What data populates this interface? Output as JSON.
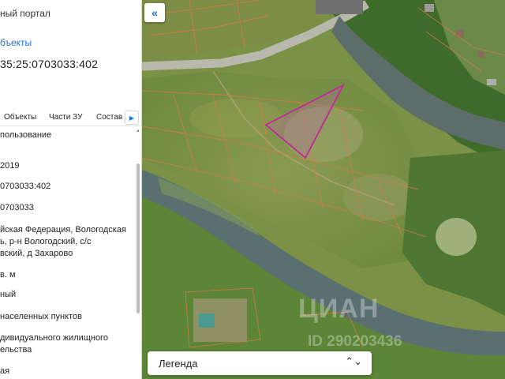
{
  "panel": {
    "title_fragment": "ный портал",
    "objects_link": "бъекты",
    "cadastral_number": "35:25:0703033:402",
    "tabs": [
      "Объекты",
      "Части ЗУ",
      "Состав"
    ],
    "rows": [
      "пользование",
      "2019",
      "0703033:402",
      "0703033",
      "йская Федерация, Вологодская\nь, р-н Вологодский, с/с\nвский, д Захарово",
      "в. м",
      "ный",
      "населенных пунктов",
      "дивидуального жилищного\nельства",
      "ая"
    ]
  },
  "map": {
    "collapse_symbol": "«",
    "watermark": "ЦИАН",
    "watermark_id": "ID 290203436",
    "legend_label": "Легенда",
    "legend_chevron": "⌃⌄"
  },
  "colors": {
    "accent": "#1a73e8",
    "parcel_highlight": "#c0289a",
    "cadastral_lines": "#d77a4a"
  }
}
